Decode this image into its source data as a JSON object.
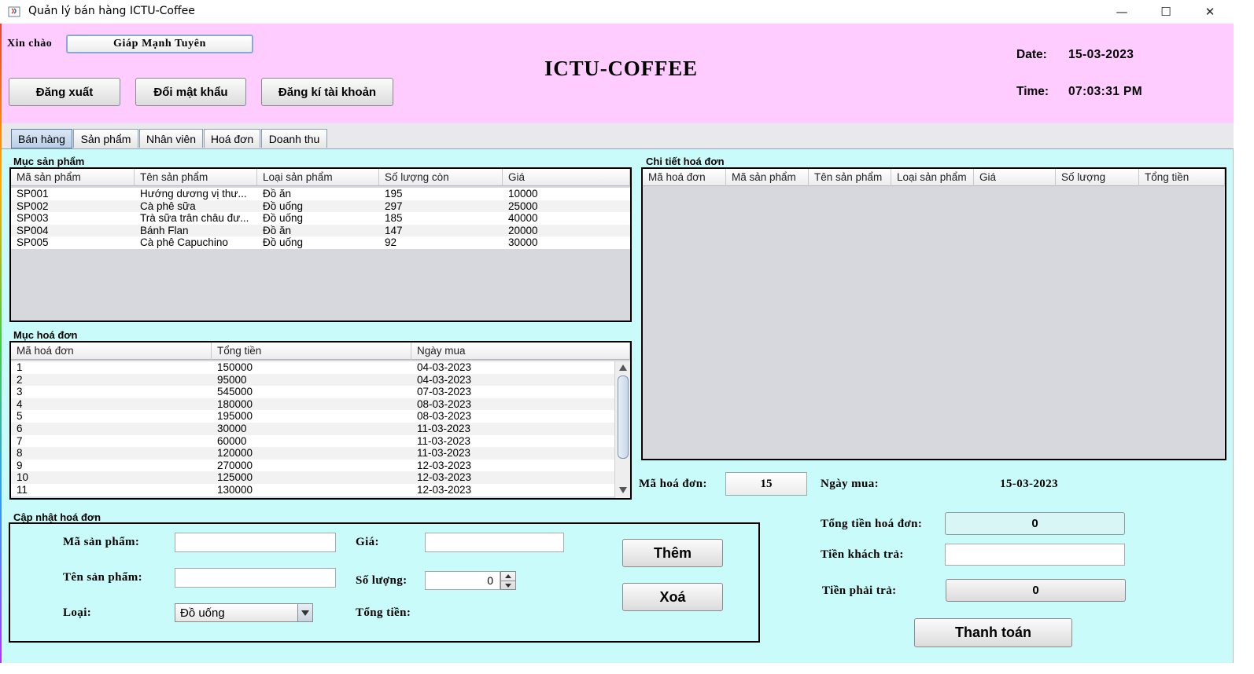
{
  "window": {
    "title": "Quản lý bán hàng ICTU-Coffee",
    "controls": [
      "—",
      "☐",
      "✕"
    ]
  },
  "header": {
    "greeting_label": "Xin chào",
    "user_name": "Giáp Mạnh Tuyên",
    "app_name": "ICTU-COFFEE",
    "buttons": {
      "logout": "Đăng xuất",
      "change_password": "Đổi mật khẩu",
      "register": "Đăng kí tài khoản"
    },
    "date_label": "Date:",
    "date_value": "15-03-2023",
    "time_label": "Time:",
    "time_value": "07:03:31 PM"
  },
  "tabs": [
    "Bán hàng",
    "Sản phẩm",
    "Nhân viên",
    "Hoá đơn",
    "Doanh thu"
  ],
  "products": {
    "title": "Mục sản phẩm",
    "columns": [
      "Mã sản phẩm",
      "Tên sản phẩm",
      "Loại sản phẩm",
      "Số lượng còn",
      "Giá"
    ],
    "rows": [
      [
        "SP001",
        "Hướng dương vị thư...",
        "Đồ ăn",
        "195",
        "10000"
      ],
      [
        "SP002",
        "Cà phê sữa",
        "Đồ uống",
        "297",
        "25000"
      ],
      [
        "SP003",
        "Trà sữa trân châu đư...",
        "Đồ uống",
        "185",
        "40000"
      ],
      [
        "SP004",
        "Bánh Flan",
        "Đồ ăn",
        "147",
        "20000"
      ],
      [
        "SP005",
        "Cà phê Capuchino",
        "Đồ uống",
        "92",
        "30000"
      ]
    ]
  },
  "invoices": {
    "title": "Mục hoá đơn",
    "columns": [
      "Mã hoá đơn",
      "Tổng tiền",
      "Ngày mua"
    ],
    "rows": [
      [
        "1",
        "150000",
        "04-03-2023"
      ],
      [
        "2",
        "95000",
        "04-03-2023"
      ],
      [
        "3",
        "545000",
        "07-03-2023"
      ],
      [
        "4",
        "180000",
        "08-03-2023"
      ],
      [
        "5",
        "195000",
        "08-03-2023"
      ],
      [
        "6",
        "30000",
        "11-03-2023"
      ],
      [
        "7",
        "60000",
        "11-03-2023"
      ],
      [
        "8",
        "120000",
        "11-03-2023"
      ],
      [
        "9",
        "270000",
        "12-03-2023"
      ],
      [
        "10",
        "125000",
        "12-03-2023"
      ],
      [
        "11",
        "130000",
        "12-03-2023"
      ]
    ]
  },
  "invoice_detail": {
    "title": "Chi tiết hoá đơn",
    "columns": [
      "Mã hoá đơn",
      "Mã sản phẩm",
      "Tên sản phẩm",
      "Loại sản phẩm",
      "Giá",
      "Số lượng",
      "Tổng tiền"
    ]
  },
  "update": {
    "title": "Cập nhật hoá đơn",
    "product_code_label": "Mã sản phẩm:",
    "product_code_value": "",
    "product_name_label": "Tên sản phẩm:",
    "product_name_value": "",
    "type_label": "Loại:",
    "type_value": "Đồ uống",
    "price_label": "Giá:",
    "price_value": "",
    "quantity_label": "Số lượng:",
    "quantity_value": "0",
    "total_label": "Tổng tiền:",
    "total_value": "",
    "add_button": "Thêm",
    "delete_button": "Xoá"
  },
  "payment": {
    "invoice_no_label": "Mã hoá đơn:",
    "invoice_no_value": "15",
    "purchase_date_label": "Ngày mua:",
    "purchase_date_value": "15-03-2023",
    "invoice_total_label": "Tổng tiền hoá đơn:",
    "invoice_total_value": "0",
    "customer_paid_label": "Tiền khách trả:",
    "customer_paid_value": "",
    "amount_due_label": "Tiền phải trả:",
    "amount_due_value": "0",
    "pay_button": "Thanh toán"
  }
}
